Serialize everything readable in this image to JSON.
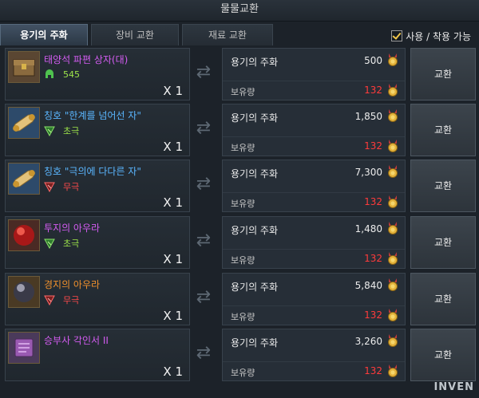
{
  "window": {
    "title": "물물교환"
  },
  "tabs": [
    {
      "label": "용기의 주화"
    },
    {
      "label": "장비 교환"
    },
    {
      "label": "재료 교환"
    }
  ],
  "filter": {
    "label": "사용 / 착용 가능"
  },
  "currency": {
    "name": "용기의 주화",
    "have_label": "보유량",
    "have_value": "132",
    "icon": "medal-icon"
  },
  "exchange_label": "교환",
  "items": [
    {
      "name": "태양석 파편 상자(대)",
      "name_color": "#d45cf2",
      "sub": "545",
      "sub_color": "#9ee64a",
      "qty": "X 1",
      "price": "500",
      "icon": "chest-icon",
      "badge": "helmet-green"
    },
    {
      "name": "칭호 \"한계를 넘어선 자\"",
      "name_color": "#5ab6ff",
      "sub": "초극",
      "sub_color": "#9ee64a",
      "qty": "X 1",
      "price": "1,850",
      "icon": "scroll-icon",
      "badge": "rune-green"
    },
    {
      "name": "칭호 \"극의에 다다른 자\"",
      "name_color": "#5ab6ff",
      "sub": "무극",
      "sub_color": "#ff4a4a",
      "qty": "X 1",
      "price": "7,300",
      "icon": "scroll-icon",
      "badge": "rune-red"
    },
    {
      "name": "투지의 아우라",
      "name_color": "#d45cf2",
      "sub": "초극",
      "sub_color": "#9ee64a",
      "qty": "X 1",
      "price": "1,480",
      "icon": "orb-red-icon",
      "badge": "rune-green"
    },
    {
      "name": "경지의 아우라",
      "name_color": "#f0902c",
      "sub": "무극",
      "sub_color": "#ff4a4a",
      "qty": "X 1",
      "price": "5,840",
      "icon": "orb-grey-icon",
      "badge": "rune-red"
    },
    {
      "name": "승부사 각인서 II",
      "name_color": "#d45cf2",
      "sub": "",
      "sub_color": "#9ee64a",
      "qty": "X 1",
      "price": "3,260",
      "icon": "book-icon",
      "badge": ""
    }
  ],
  "watermark": "INVEN"
}
